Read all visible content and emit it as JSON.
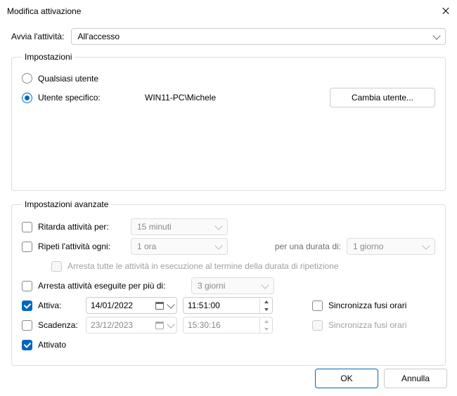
{
  "window": {
    "title": "Modifica attivazione"
  },
  "start": {
    "label": "Avvia l'attività:",
    "value": "All'accesso"
  },
  "settings": {
    "legend": "Impostazioni",
    "any_user": "Qualsiasi utente",
    "specific_user": "Utente specifico:",
    "user_value": "WIN11-PC\\Michele",
    "change_user_btn": "Cambia utente..."
  },
  "advanced": {
    "legend": "Impostazioni avanzate",
    "delay_label": "Ritarda attività per:",
    "delay_value": "15 minuti",
    "repeat_label": "Ripeti l'attività ogni:",
    "repeat_value": "1 ora",
    "duration_label": "per una durata di:",
    "duration_value": "1 giorno",
    "stop_all_label": "Arresta tutte le attività in esecuzione al termine della durata di ripetizione",
    "stop_long_label": "Arresta attività eseguite per più di:",
    "stop_long_value": "3 giorni",
    "activate_label": "Attiva:",
    "activate_date": "14/01/2022",
    "activate_time": "11:51:00",
    "sync_label": "Sincronizza fusi orari",
    "expire_label": "Scadenza:",
    "expire_date": "23/12/2023",
    "expire_time": "15:30:16",
    "enabled_label": "Attivato"
  },
  "footer": {
    "ok": "OK",
    "cancel": "Annulla"
  }
}
